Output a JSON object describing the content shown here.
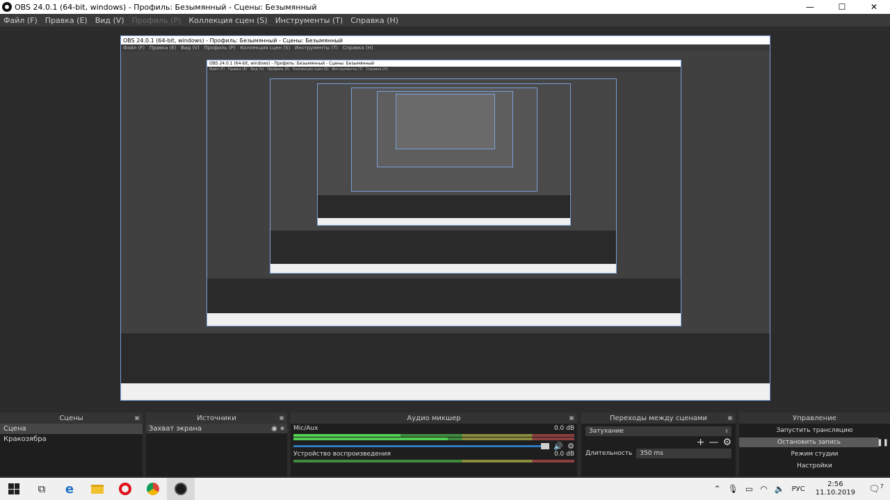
{
  "window": {
    "title": "OBS 24.0.1 (64-bit, windows) - Профиль: Безымянный - Сцены: Безымянный",
    "minimize": "—",
    "maximize": "☐",
    "close": "✕"
  },
  "menu": [
    {
      "label": "Файл (F)",
      "disabled": false
    },
    {
      "label": "Правка (E)",
      "disabled": false
    },
    {
      "label": "Вид (V)",
      "disabled": false
    },
    {
      "label": "Профиль (P)",
      "disabled": true
    },
    {
      "label": "Коллекция сцен (S)",
      "disabled": false
    },
    {
      "label": "Инструменты (T)",
      "disabled": false
    },
    {
      "label": "Справка (H)",
      "disabled": false
    }
  ],
  "docks": {
    "scenes": {
      "title": "Сцены",
      "items": [
        "Сцена",
        "Кракозябра"
      ]
    },
    "sources": {
      "title": "Источники",
      "items": [
        "Захват экрана"
      ]
    },
    "mixer": {
      "title": "Аудио микшер",
      "tracks": [
        {
          "name": "Mic/Aux",
          "db": "0.0 dB"
        },
        {
          "name": "Устройство воспроизведения",
          "db": "0.0 dB"
        }
      ]
    },
    "transitions": {
      "title": "Переходы между сценами",
      "selected": "Затухание",
      "duration_label": "Длительность",
      "duration_value": "350 ms"
    },
    "controls": {
      "title": "Управление",
      "buttons": [
        "Запустить трансляцию",
        "Остановить запись",
        "Режим студии",
        "Настройки"
      ]
    }
  },
  "tray": {
    "language": "РУС",
    "time": "2:56",
    "date": "11.10.2019",
    "notifications": "7"
  }
}
